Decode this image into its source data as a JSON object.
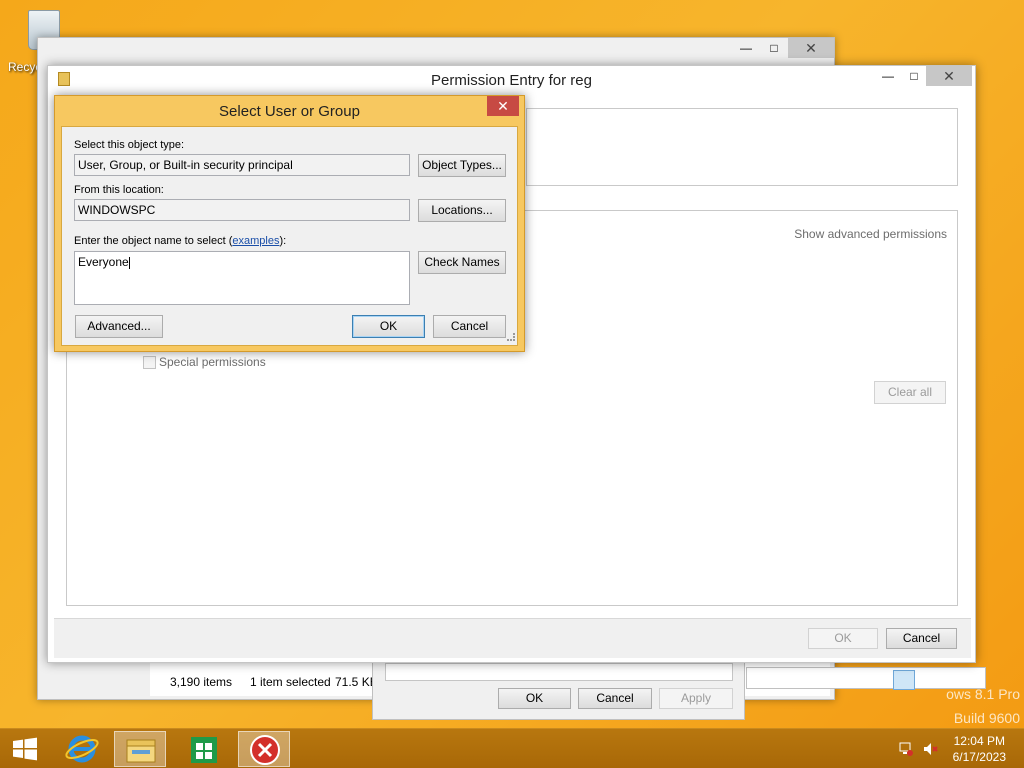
{
  "desktop": {
    "recycle_bin_label": "Recyc",
    "watermark_line1": "ows 8.1 Pro",
    "watermark_line2": "Build 9600"
  },
  "explorer": {
    "status_items": "3,190 items",
    "status_selected": "1 item selected",
    "status_size": "71.5 KB"
  },
  "properties": {
    "ok": "OK",
    "cancel": "Cancel",
    "apply": "Apply"
  },
  "permission_entry": {
    "title": "Permission Entry for reg",
    "show_advanced": "Show advanced permissions",
    "special_permissions": "Special permissions",
    "clear_all": "Clear all",
    "ok": "OK",
    "cancel": "Cancel"
  },
  "select_dialog": {
    "title": "Select User or Group",
    "object_type_label": "Select this object type:",
    "object_type_value": "User, Group, or Built-in security principal",
    "object_types_button": "Object Types...",
    "location_label": "From this location:",
    "location_value": "WINDOWSPC",
    "locations_button": "Locations...",
    "object_name_label_prefix": "Enter the object name to select (",
    "object_name_link": "examples",
    "object_name_label_suffix": "):",
    "object_name_value": "Everyone",
    "check_names_button": "Check Names",
    "advanced_button": "Advanced...",
    "ok": "OK",
    "cancel": "Cancel"
  },
  "taskbar": {
    "time": "12:04 PM",
    "date": "6/17/2023"
  },
  "colors": {
    "desktop": "#f5a81a",
    "dialog_frame": "#f7c860",
    "close_red": "#c74a43",
    "link": "#1a4ea8"
  }
}
